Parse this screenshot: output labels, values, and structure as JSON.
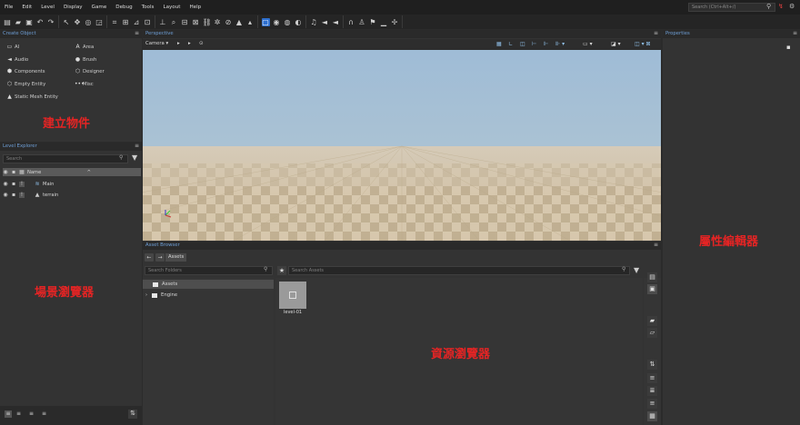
{
  "menu": [
    "File",
    "Edit",
    "Level",
    "Display",
    "Game",
    "Debug",
    "Tools",
    "Layout",
    "Help"
  ],
  "top_search": {
    "placeholder": "Search (Ctrl+Alt+/)"
  },
  "create_object": {
    "title": "Create Object",
    "items": [
      "AI",
      "Area",
      "Audio",
      "Brush",
      "Components",
      "Designer",
      "Empty Entity",
      "Misc",
      "Static Mesh Entity"
    ]
  },
  "level_explorer": {
    "title": "Level Explorer",
    "search_placeholder": "Search",
    "column": "Name",
    "rows": [
      "Main",
      "terrain"
    ]
  },
  "viewport": {
    "title": "Perspective",
    "camera_label": "Camera"
  },
  "properties": {
    "title": "Properties"
  },
  "asset_browser": {
    "title": "Asset Browser",
    "breadcrumb": "Assets",
    "folder_search_placeholder": "Search Folders",
    "asset_search_placeholder": "Search Assets",
    "folders": [
      "Assets",
      "Engine"
    ],
    "assets": [
      {
        "name": "level-01"
      }
    ]
  },
  "labels": {
    "create_object": "建立物件",
    "level_explorer": "場景瀏覽器",
    "properties": "屬性編輯器",
    "asset_browser": "資源瀏覽器"
  },
  "colors": {
    "accent": "#2d6fcf",
    "panel_title": "#6fa0d8",
    "annotation": "#e52424",
    "sky": "#a4bfd6",
    "ground": "#d4c4aa"
  }
}
